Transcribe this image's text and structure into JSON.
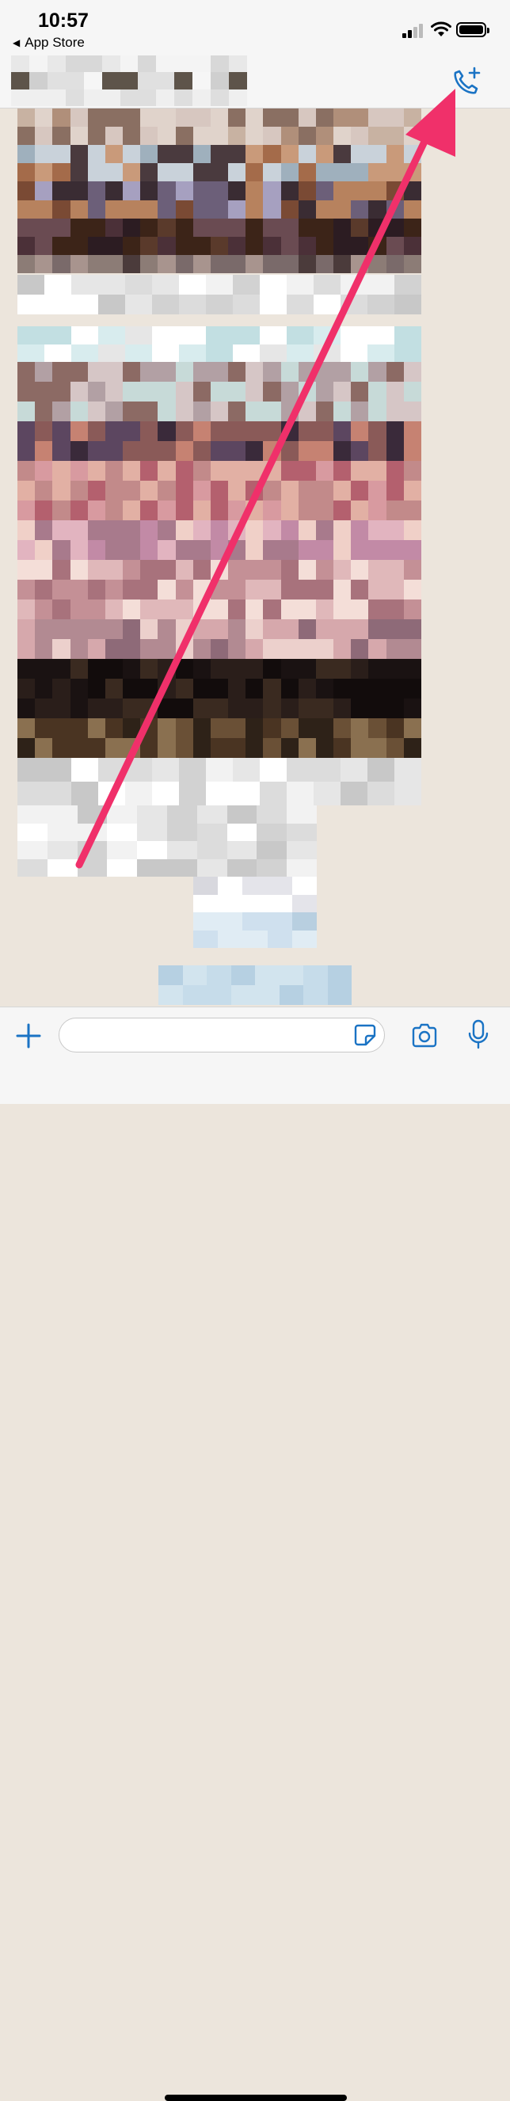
{
  "status_bar": {
    "time": "10:57",
    "back_app_label": "App Store",
    "back_app_icon": "left-triangle-icon",
    "icons": [
      "cellular-signal-icon",
      "wifi-icon",
      "battery-icon"
    ]
  },
  "nav_bar": {
    "back_icon": "chevron-left-icon",
    "contact_name": "",
    "call_icon": "phone-plus-icon"
  },
  "input_bar": {
    "attach_icon": "plus-icon",
    "message_value": "",
    "message_placeholder": "",
    "sticker_icon": "sticker-icon",
    "camera_icon": "camera-icon",
    "mic_icon": "microphone-icon"
  },
  "colors": {
    "accent": "#1a73c4",
    "annotation_arrow": "#f0306a",
    "chat_background": "#ece5dc",
    "bar_background": "#f6f6f6"
  }
}
